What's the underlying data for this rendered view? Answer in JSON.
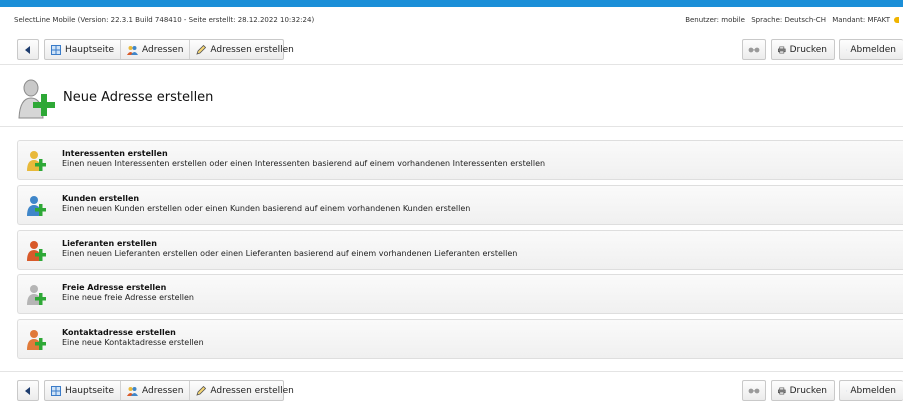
{
  "info": {
    "left": "SelectLine Mobile (Version: 22.3.1 Build 748410 - Seite erstellt: 28.12.2022 10:32:24)",
    "user": "Benutzer: mobile",
    "language": "Sprache: Deutsch-CH",
    "client": "Mandant: MFAKT"
  },
  "toolbar": {
    "back_icon": "triangle-left-icon",
    "home_label": "Hauptseite",
    "addresses_label": "Adressen",
    "create_label": "Adressen erstellen",
    "print_label": "Drucken",
    "logout_label": "Abmelden"
  },
  "page": {
    "title": "Neue Adresse erstellen"
  },
  "items": [
    {
      "title": "Interessenten erstellen",
      "desc": "Einen neuen Interessenten erstellen oder einen Interessenten basierend auf einem vorhandenen Interessenten erstellen",
      "color": "#e8b93a"
    },
    {
      "title": "Kunden erstellen",
      "desc": "Einen neuen Kunden erstellen oder einen Kunden basierend auf einem vorhandenen Kunden erstellen",
      "color": "#3f86c9"
    },
    {
      "title": "Lieferanten erstellen",
      "desc": "Einen neuen Lieferanten erstellen oder einen Lieferanten basierend auf einem vorhandenen Lieferanten erstellen",
      "color": "#d85a2a"
    },
    {
      "title": "Freie Adresse erstellen",
      "desc": "Eine neue freie Adresse erstellen",
      "color": "#9a9a9a"
    },
    {
      "title": "Kontaktadresse erstellen",
      "desc": "Eine neue Kontaktadresse erstellen",
      "color": "#e07a3a"
    }
  ],
  "colors": {
    "accent": "#1b8fd8",
    "plus": "#2ea836"
  }
}
